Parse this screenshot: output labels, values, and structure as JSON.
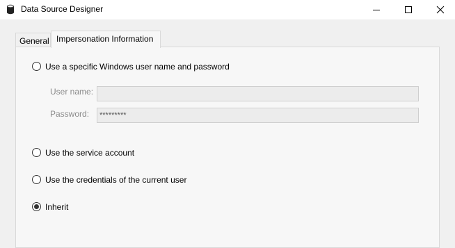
{
  "window": {
    "title": "Data Source Designer",
    "icon": "database-icon",
    "controls": [
      "minimize-icon",
      "maximize-icon",
      "close-icon"
    ]
  },
  "tabs": [
    {
      "label": "General",
      "active": false
    },
    {
      "label": "Impersonation Information",
      "active": true
    }
  ],
  "impersonation": {
    "options": [
      {
        "label": "Use a specific Windows user name and password",
        "selected": false
      },
      {
        "label": "Use the service account",
        "selected": false
      },
      {
        "label": "Use the credentials of the current user",
        "selected": false
      },
      {
        "label": "Inherit",
        "selected": true
      }
    ],
    "username": {
      "label": "User name:",
      "value": ""
    },
    "password": {
      "label": "Password:",
      "value": "*********"
    }
  }
}
